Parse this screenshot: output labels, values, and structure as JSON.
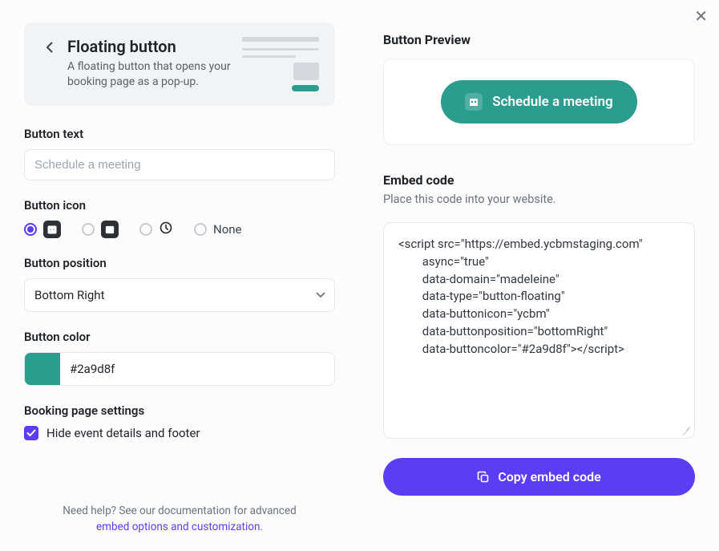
{
  "header": {
    "title": "Floating button",
    "description": "A floating button that opens your booking page as a pop-up."
  },
  "form": {
    "button_text": {
      "label": "Button text",
      "placeholder": "Schedule a meeting",
      "value": ""
    },
    "button_icon": {
      "label": "Button icon",
      "selected_index": 0,
      "none_label": "None"
    },
    "button_position": {
      "label": "Button position",
      "value": "Bottom Right"
    },
    "button_color": {
      "label": "Button color",
      "value": "#2a9d8f"
    },
    "booking_settings": {
      "label": "Booking page settings",
      "hide_details": {
        "checked": true,
        "label": "Hide event details and footer"
      }
    }
  },
  "help": {
    "prefix": "Need help? See our documentation for advanced ",
    "link": "embed options and customization."
  },
  "preview": {
    "label": "Button Preview",
    "button_text": "Schedule a meeting"
  },
  "embed": {
    "label": "Embed code",
    "hint": "Place this code into your website.",
    "code": "<script src=\"https://embed.ycbmstaging.com\"\n        async=\"true\"\n        data-domain=\"madeleine\"\n        data-type=\"button-floating\"\n        data-buttonicon=\"ycbm\"\n        data-buttonposition=\"bottomRight\"\n        data-buttoncolor=\"#2a9d8f\"></script>",
    "copy_label": "Copy embed code"
  }
}
